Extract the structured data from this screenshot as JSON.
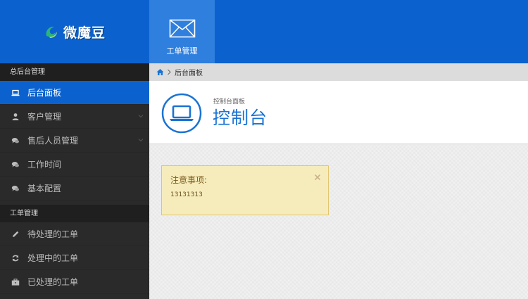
{
  "brand": {
    "name": "微魔豆"
  },
  "top_nav": {
    "tab_label": "工单管理"
  },
  "sidebar": {
    "section1_title": "总后台管理",
    "section1_items": [
      {
        "label": "后台面板",
        "icon": "laptop-icon",
        "active": true
      },
      {
        "label": "客户管理",
        "icon": "user-icon",
        "has_children": true
      },
      {
        "label": "售后人员管理",
        "icon": "comments-icon",
        "has_children": true
      },
      {
        "label": "工作时间",
        "icon": "comments-icon"
      },
      {
        "label": "基本配置",
        "icon": "comments-icon"
      }
    ],
    "section2_title": "工单管理",
    "section2_items": [
      {
        "label": "待处理的工单",
        "icon": "pencil-icon"
      },
      {
        "label": "处理中的工单",
        "icon": "refresh-icon"
      },
      {
        "label": "已处理的工单",
        "icon": "briefcase-icon"
      }
    ]
  },
  "breadcrumb": {
    "current": "后台面板"
  },
  "page_header": {
    "subtitle": "控制台面板",
    "title": "控制台"
  },
  "notice": {
    "title": "注意事项:",
    "body": "13131313"
  },
  "colors": {
    "primary": "#0b62cf",
    "sidebar_bg": "#2a2a2a",
    "notice_bg": "#f6ecbb",
    "title_blue": "#1a73d4"
  }
}
